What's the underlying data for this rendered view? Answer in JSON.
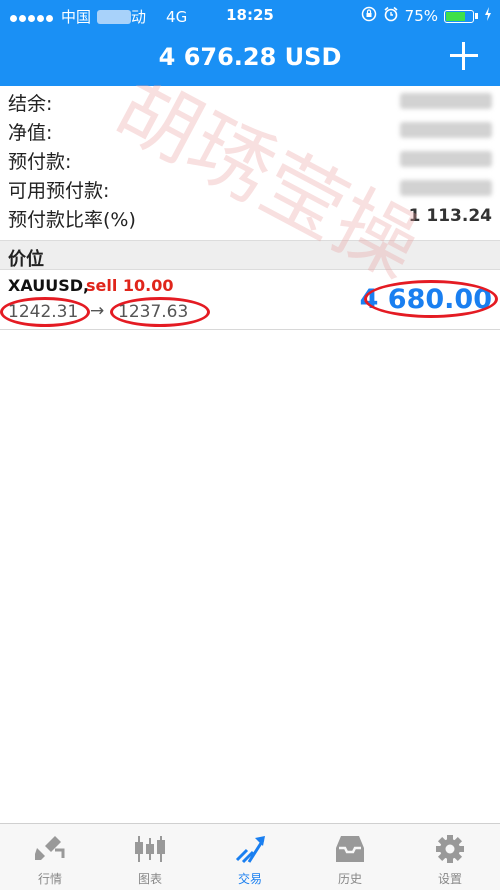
{
  "status_bar": {
    "carrier": "中国",
    "carrier_suffix": "动",
    "network": "4G",
    "time": "18:25",
    "battery": "75%",
    "battery_level": 0.75
  },
  "header": {
    "title": "4 676.28 USD"
  },
  "summary": {
    "balance_label": "结余:",
    "equity_label": "净值:",
    "margin_label": "预付款:",
    "free_margin_label": "可用预付款:",
    "margin_level_label": "预付款比率(%)",
    "margin_level_value": "1 113.24"
  },
  "section": {
    "title": "价位"
  },
  "position": {
    "symbol": "XAUUSD,",
    "type": "sell 10.00",
    "open_price": "1242.31",
    "arrow": "→",
    "current_price": "1237.63",
    "profit": "4 680.00"
  },
  "watermark": {
    "text": "胡琇莹操"
  },
  "tabs": [
    {
      "label": "行情",
      "icon": "quotes-icon"
    },
    {
      "label": "图表",
      "icon": "chart-icon"
    },
    {
      "label": "交易",
      "icon": "trade-icon"
    },
    {
      "label": "历史",
      "icon": "history-icon"
    },
    {
      "label": "设置",
      "icon": "settings-icon"
    }
  ],
  "colors": {
    "accent": "#1a90f5",
    "sell": "#e0251b",
    "profit": "#1a7ff0",
    "annotation": "#e41b23"
  }
}
